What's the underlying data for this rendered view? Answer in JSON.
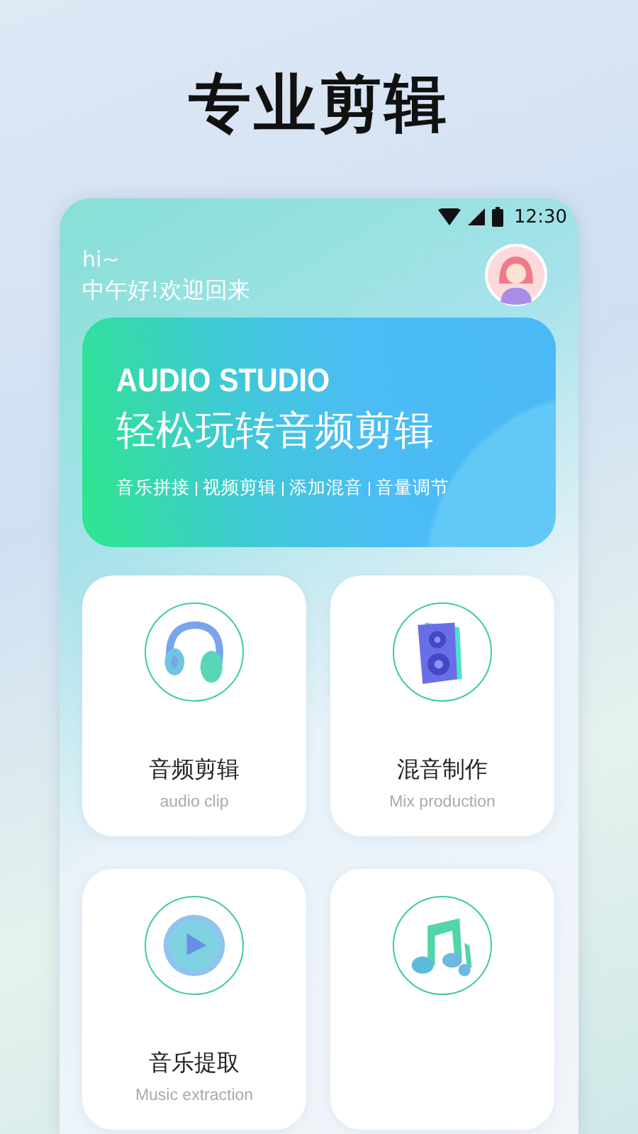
{
  "headline": "专业剪辑",
  "status_bar": {
    "time": "12:30"
  },
  "greeting": {
    "hi": "hi~",
    "message": "中午好!欢迎回来"
  },
  "banner": {
    "brand": "AUDIO STUDIO",
    "title": "轻松玩转音频剪辑",
    "features": [
      "音乐拼接",
      "视频剪辑",
      "添加混音",
      "音量调节"
    ]
  },
  "tools": [
    {
      "kind": "headphones",
      "title": "音频剪辑",
      "subtitle": "audio clip"
    },
    {
      "kind": "speaker",
      "title": "混音制作",
      "subtitle": "Mix production"
    },
    {
      "kind": "play",
      "title": "音乐提取",
      "subtitle": "Music extraction"
    },
    {
      "kind": "note"
    }
  ]
}
